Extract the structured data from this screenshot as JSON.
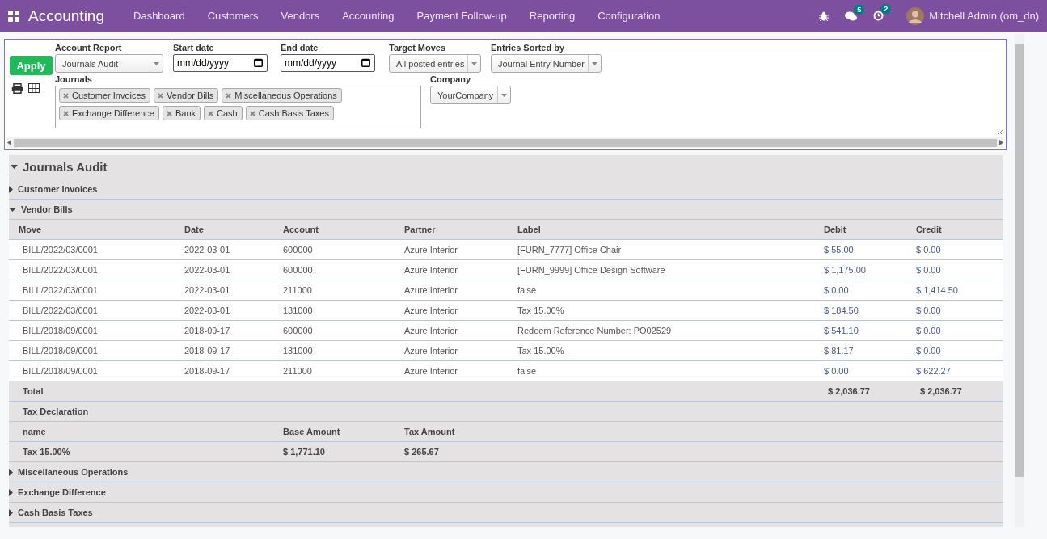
{
  "navbar": {
    "app_title": "Accounting",
    "menu": [
      "Dashboard",
      "Customers",
      "Vendors",
      "Accounting",
      "Payment Follow-up",
      "Reporting",
      "Configuration"
    ],
    "messages_count": "5",
    "activities_count": "2",
    "user": "Mitchell Admin (om_dn)"
  },
  "filters": {
    "apply": "Apply",
    "account_report": {
      "label": "Account Report",
      "value": "Journals Audit"
    },
    "start_date": {
      "label": "Start date",
      "placeholder": "mm/dd/yyyy"
    },
    "end_date": {
      "label": "End date",
      "placeholder": "mm/dd/yyyy"
    },
    "target_moves": {
      "label": "Target Moves",
      "value": "All posted entries"
    },
    "sorted_by": {
      "label": "Entries Sorted by",
      "value": "Journal Entry Number"
    },
    "journals": {
      "label": "Journals",
      "tags": [
        [
          "Customer Invoices",
          "Vendor Bills",
          "Miscellaneous Operations"
        ],
        [
          "Exchange Difference",
          "Bank",
          "Cash",
          "Cash Basis Taxes"
        ]
      ]
    },
    "company": {
      "label": "Company",
      "value": "YourCompany"
    }
  },
  "report": {
    "title": "Journals Audit",
    "expanded": true,
    "journals": [
      {
        "name": "Customer Invoices",
        "expanded": false
      },
      {
        "name": "Vendor Bills",
        "expanded": true,
        "columns": [
          "Move",
          "Date",
          "Account",
          "Partner",
          "Label",
          "Debit",
          "Credit"
        ],
        "lines": [
          [
            "BILL/2022/03/0001",
            "2022-03-01",
            "600000",
            "Azure Interior",
            "[FURN_7777] Office Chair",
            "$ 55.00",
            "$ 0.00"
          ],
          [
            "BILL/2022/03/0001",
            "2022-03-01",
            "600000",
            "Azure Interior",
            "[FURN_9999] Office Design Software",
            "$ 1,175.00",
            "$ 0.00"
          ],
          [
            "BILL/2022/03/0001",
            "2022-03-01",
            "211000",
            "Azure Interior",
            "false",
            "$ 0.00",
            "$ 1,414.50"
          ],
          [
            "BILL/2022/03/0001",
            "2022-03-01",
            "131000",
            "Azure Interior",
            "Tax 15.00%",
            "$ 184.50",
            "$ 0.00"
          ],
          [
            "BILL/2018/09/0001",
            "2018-09-17",
            "600000",
            "Azure Interior",
            "Redeem Reference Number: PO02529",
            "$ 541.10",
            "$ 0.00"
          ],
          [
            "BILL/2018/09/0001",
            "2018-09-17",
            "131000",
            "Azure Interior",
            "Tax 15.00%",
            "$ 81.17",
            "$ 0.00"
          ],
          [
            "BILL/2018/09/0001",
            "2018-09-17",
            "211000",
            "Azure Interior",
            "false",
            "$ 0.00",
            "$ 622.27"
          ]
        ],
        "total": {
          "label": "Total",
          "debit": "$ 2,036.77",
          "credit": "$ 2,036.77"
        },
        "tax_declaration": {
          "title": "Tax Declaration",
          "columns": [
            "name",
            "Base Amount",
            "Tax Amount"
          ],
          "rows": [
            [
              "Tax 15.00%",
              "$ 1,771.10",
              "$ 265.67"
            ]
          ]
        }
      },
      {
        "name": "Miscellaneous Operations",
        "expanded": false
      },
      {
        "name": "Exchange Difference",
        "expanded": false
      },
      {
        "name": "Cash Basis Taxes",
        "expanded": false
      }
    ]
  }
}
